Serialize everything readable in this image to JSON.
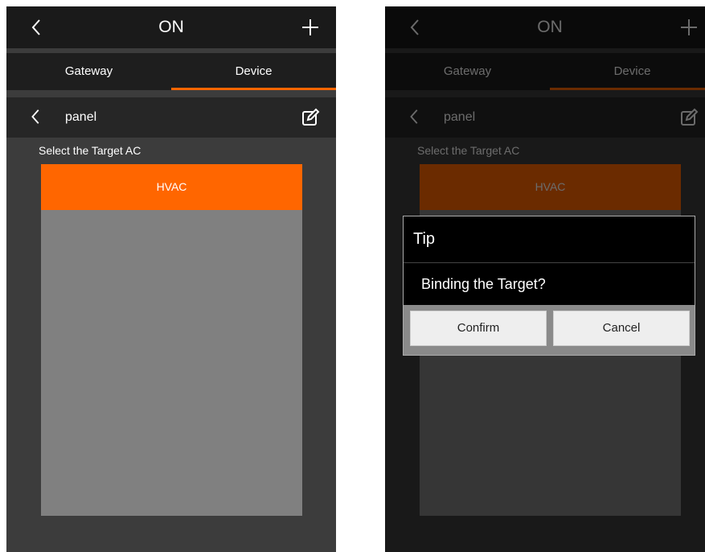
{
  "colors": {
    "accent": "#ff6600",
    "topbar": "#1a1a1a",
    "background": "#3c3c3c",
    "list": "#808080"
  },
  "header": {
    "title": "ON"
  },
  "tabs": [
    {
      "label": "Gateway"
    },
    {
      "label": "Device"
    }
  ],
  "panel": {
    "label": "panel"
  },
  "instruction": "Select the Target AC",
  "list": {
    "items": [
      {
        "label": "HVAC"
      }
    ]
  },
  "dialog": {
    "title": "Tip",
    "message": "Binding the Target?",
    "confirm_label": "Confirm",
    "cancel_label": "Cancel"
  }
}
